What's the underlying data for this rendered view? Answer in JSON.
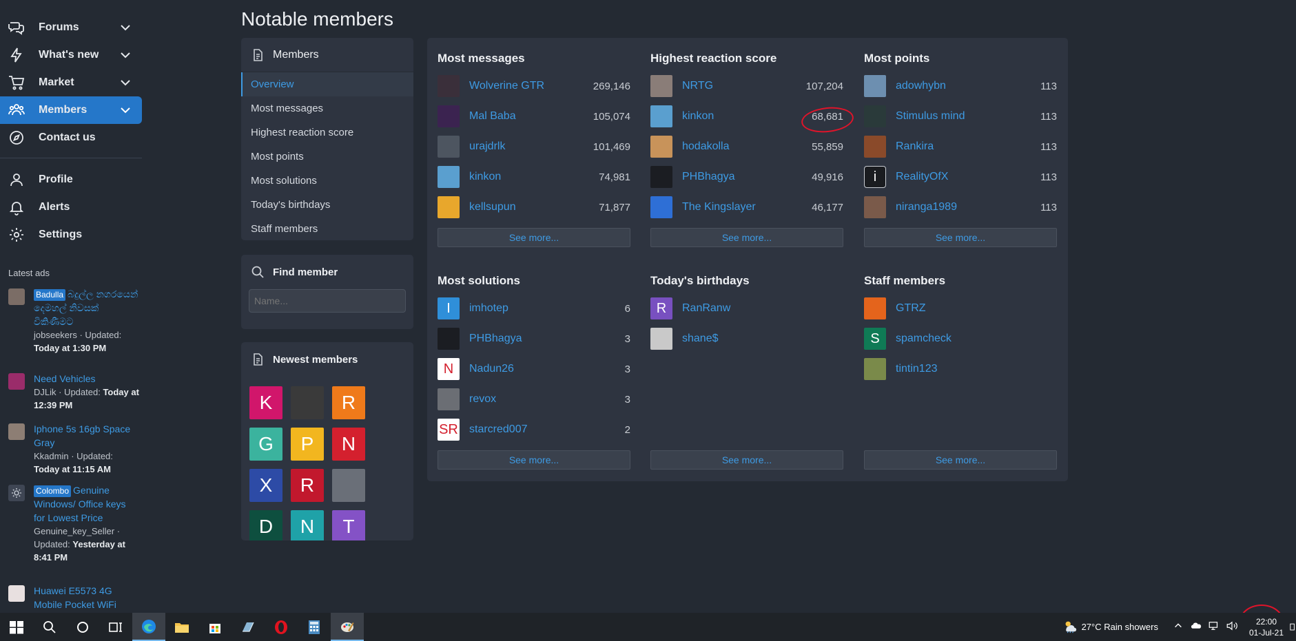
{
  "nav": {
    "items": [
      {
        "label": "Forums",
        "icon": "forums-icon",
        "chevron": true
      },
      {
        "label": "What's new",
        "icon": "lightning-icon",
        "chevron": true
      },
      {
        "label": "Market",
        "icon": "cart-icon",
        "chevron": true
      },
      {
        "label": "Members",
        "icon": "users-icon",
        "chevron": true,
        "active": true
      },
      {
        "label": "Contact us",
        "icon": "compass-icon",
        "chevron": false
      }
    ],
    "account": [
      {
        "label": "Profile",
        "icon": "user-icon"
      },
      {
        "label": "Alerts",
        "icon": "bell-icon"
      },
      {
        "label": "Settings",
        "icon": "gear-icon"
      }
    ]
  },
  "ads": {
    "title": "Latest ads",
    "items": [
      {
        "tag": "Badulla",
        "title": "බදුල්ල නගරයෙන් දෙමහල් නිවසක් විකිණීමට",
        "meta_prefix": "jobseekers · Updated:",
        "meta_bold": "Today at 1:30 PM"
      },
      {
        "tag": "",
        "title": "Need Vehicles",
        "meta_prefix": "DJLik · Updated:",
        "meta_bold": "Today at 12:39 PM"
      },
      {
        "tag": "",
        "title": "Iphone 5s 16gb Space Gray",
        "meta_prefix": "Kkadmin · Updated:",
        "meta_bold": "Today at 11:15 AM"
      },
      {
        "tag": "Colombo",
        "title": "Genuine Windows/ Office keys for Lowest Price",
        "meta_prefix": "Genuine_key_Seller · Updated:",
        "meta_bold": "Yesterday at 8:41 PM"
      },
      {
        "tag": "",
        "title": "Huawei E5573 4G Mobile Pocket WiFi",
        "meta_prefix": "",
        "meta_bold": ""
      }
    ]
  },
  "page": {
    "title": "Notable members"
  },
  "members_menu": {
    "heading": "Members",
    "items": [
      "Overview",
      "Most messages",
      "Highest reaction score",
      "Most points",
      "Most solutions",
      "Today's birthdays",
      "Staff members"
    ],
    "active_index": 0
  },
  "find": {
    "heading": "Find member",
    "placeholder": "Name..."
  },
  "newest": {
    "heading": "Newest members",
    "avatars": [
      {
        "letter": "K",
        "color": "#d1166b"
      },
      {
        "letter": "",
        "color": "#3a3a3a"
      },
      {
        "letter": "R",
        "color": "#ef7a1a"
      },
      {
        "letter": "G",
        "color": "#3bb39e"
      },
      {
        "letter": "P",
        "color": "#f2b61f"
      },
      {
        "letter": "N",
        "color": "#d4202e"
      },
      {
        "letter": "X",
        "color": "#2d4ba6"
      },
      {
        "letter": "R",
        "color": "#c2182d"
      },
      {
        "letter": "",
        "color": "#6a6f78"
      },
      {
        "letter": "D",
        "color": "#0e4f3f"
      },
      {
        "letter": "N",
        "color": "#1fa2a8"
      },
      {
        "letter": "T",
        "color": "#8452c6"
      }
    ]
  },
  "columns": [
    {
      "title": "Most messages",
      "rows": [
        {
          "name": "Wolverine GTR",
          "value": "269,146",
          "avatar": "",
          "color": "#3a2f3a"
        },
        {
          "name": "Mal Baba",
          "value": "105,074",
          "avatar": "",
          "color": "#3b2350"
        },
        {
          "name": "urajdrlk",
          "value": "101,469",
          "avatar": "",
          "color": "#4d5560"
        },
        {
          "name": "kinkon",
          "value": "74,981",
          "avatar": "",
          "color": "#5a9fcf"
        },
        {
          "name": "kellsupun",
          "value": "71,877",
          "avatar": "",
          "color": "#e8a72c"
        }
      ],
      "see_more": "See more..."
    },
    {
      "title": "Highest reaction score",
      "rows": [
        {
          "name": "NRTG",
          "value": "107,204",
          "avatar": "",
          "color": "#8a7d78"
        },
        {
          "name": "kinkon",
          "value": "68,681",
          "avatar": "",
          "color": "#5a9fcf"
        },
        {
          "name": "hodakolla",
          "value": "55,859",
          "avatar": "",
          "color": "#c8935a"
        },
        {
          "name": "PHBhagya",
          "value": "49,916",
          "avatar": "",
          "color": "#1b1d22"
        },
        {
          "name": "The Kingslayer",
          "value": "46,177",
          "avatar": "",
          "color": "#2e6fd6"
        }
      ],
      "see_more": "See more..."
    },
    {
      "title": "Most points",
      "rows": [
        {
          "name": "adowhybn",
          "value": "113",
          "avatar": "",
          "color": "#6d8fb0"
        },
        {
          "name": "Stimulus mind",
          "value": "113",
          "avatar": "",
          "color": "#2a3a3a"
        },
        {
          "name": "Rankira",
          "value": "113",
          "avatar": "",
          "color": "#8a4a2a"
        },
        {
          "name": "RealityOfX",
          "value": "113",
          "avatar": "i",
          "color": "#1a1c20"
        },
        {
          "name": "niranga1989",
          "value": "113",
          "avatar": "",
          "color": "#7a5a4a"
        }
      ],
      "see_more": "See more..."
    },
    {
      "title": "Most solutions",
      "rows": [
        {
          "name": "imhotep",
          "value": "6",
          "avatar": "I",
          "color": "#2f8fd9"
        },
        {
          "name": "PHBhagya",
          "value": "3",
          "avatar": "",
          "color": "#1b1d22"
        },
        {
          "name": "Nadun26",
          "value": "3",
          "avatar": "N",
          "color": "#ffffff"
        },
        {
          "name": "revox",
          "value": "3",
          "avatar": "",
          "color": "#6b6e74"
        },
        {
          "name": "starcred007",
          "value": "2",
          "avatar": "SR",
          "color": "#ffffff"
        }
      ],
      "see_more": "See more..."
    },
    {
      "title": "Today's birthdays",
      "rows": [
        {
          "name": "RanRanw",
          "value": "",
          "avatar": "R",
          "color": "#7850c0"
        },
        {
          "name": "shane$",
          "value": "",
          "avatar": "",
          "color": "#c9c9c9"
        }
      ],
      "see_more": "See more..."
    },
    {
      "title": "Staff members",
      "rows": [
        {
          "name": "GTRZ",
          "value": "",
          "avatar": "",
          "color": "#e4641c"
        },
        {
          "name": "spamcheck",
          "value": "",
          "avatar": "S",
          "color": "#0f7a55"
        },
        {
          "name": "tintin123",
          "value": "",
          "avatar": "",
          "color": "#7a8a4a"
        }
      ],
      "see_more": "See more..."
    }
  ],
  "taskbar": {
    "weather": "27°C  Rain showers",
    "time": "22:00",
    "date": "01-Jul-21"
  }
}
